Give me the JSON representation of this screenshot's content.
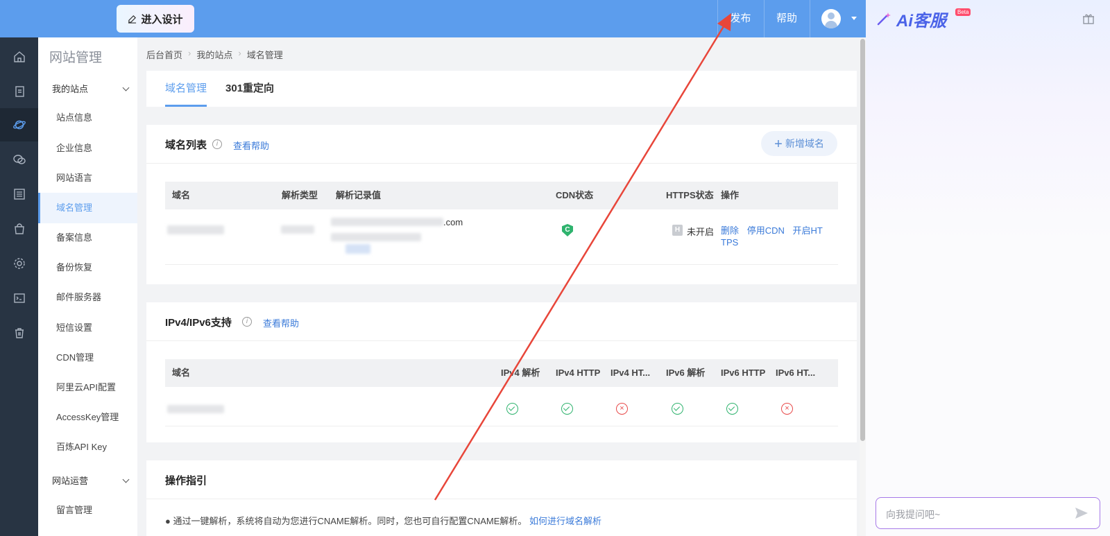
{
  "topbar": {
    "design_button": "进入设计",
    "publish": "发布",
    "help": "帮助"
  },
  "sidemenu": {
    "title": "网站管理",
    "group_my_sites": "我的站点",
    "items": [
      "站点信息",
      "企业信息",
      "网站语言",
      "域名管理",
      "备案信息",
      "备份恢复",
      "邮件服务器",
      "短信设置",
      "CDN管理",
      "阿里云API配置",
      "AccessKey管理",
      "百炼API Key"
    ],
    "active_item": "域名管理",
    "group_ops": "网站运营",
    "ops_items": [
      "留言管理"
    ]
  },
  "breadcrumb": [
    "后台首页",
    "我的站点",
    "域名管理"
  ],
  "tabs": [
    "域名管理",
    "301重定向"
  ],
  "domain_list": {
    "title": "域名列表",
    "help": "查看帮助",
    "add_button": "新增域名",
    "columns": [
      "域名",
      "解析类型",
      "解析记录值",
      "CDN状态",
      "HTTPS状态",
      "操作"
    ],
    "row": {
      "record_suffix": ".com",
      "cdn_badge": "C",
      "https_badge": "H",
      "https_status": "未开启",
      "actions": [
        "删除",
        "停用CDN",
        "开启HT",
        "TPS"
      ]
    }
  },
  "ipv": {
    "title": "IPv4/IPv6支持",
    "help": "查看帮助",
    "columns": [
      "域名",
      "IPv4 解析",
      "IPv4 HTTP",
      "IPv4 HT...",
      "IPv6 解析",
      "IPv6 HTTP",
      "IPv6 HT..."
    ],
    "row_status": [
      "ok",
      "ok",
      "fail",
      "ok",
      "ok",
      "fail"
    ],
    "fail_mark": "×"
  },
  "guide": {
    "title": "操作指引",
    "text": "● 通过一键解析，系统将自动为您进行CNAME解析。同时，您也可自行配置CNAME解析。",
    "link": "如何进行域名解析"
  },
  "ai_panel": {
    "logo_text": "Ai客服",
    "beta": "Beta",
    "input_placeholder": "向我提问吧~"
  },
  "colors": {
    "topbar": "#5c9ded",
    "rail": "#283443",
    "accent": "#5c9ded",
    "ok": "#2fb36e",
    "fail": "#e84a4a",
    "annotation_arrow": "#e8463a"
  }
}
